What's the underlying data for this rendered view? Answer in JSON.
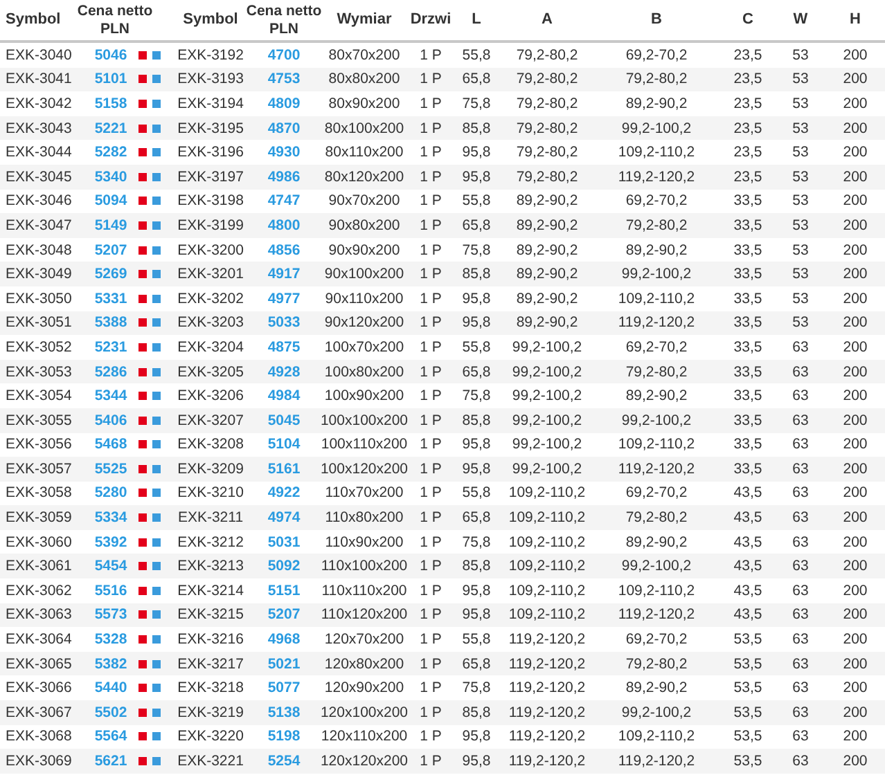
{
  "table": {
    "columns": [
      {
        "label": "Symbol",
        "kind": "text"
      },
      {
        "label": "Cena netto PLN",
        "kind": "price",
        "markers": true
      },
      {
        "label": "Symbol",
        "kind": "text"
      },
      {
        "label": "Cena netto PLN",
        "kind": "price"
      },
      {
        "label": "Wymiar",
        "kind": "text"
      },
      {
        "label": "Drzwi",
        "kind": "text"
      },
      {
        "label": "L",
        "kind": "text"
      },
      {
        "label": "A",
        "kind": "text"
      },
      {
        "label": "B",
        "kind": "text"
      },
      {
        "label": "C",
        "kind": "text"
      },
      {
        "label": "W",
        "kind": "text"
      },
      {
        "label": "H",
        "kind": "text"
      }
    ],
    "rows": [
      [
        "EXK-3040",
        "5046",
        "EXK-3192",
        "4700",
        "80x70x200",
        "1 P",
        "55,8",
        "79,2-80,2",
        "69,2-70,2",
        "23,5",
        "53",
        "200"
      ],
      [
        "EXK-3041",
        "5101",
        "EXK-3193",
        "4753",
        "80x80x200",
        "1 P",
        "65,8",
        "79,2-80,2",
        "79,2-80,2",
        "23,5",
        "53",
        "200"
      ],
      [
        "EXK-3042",
        "5158",
        "EXK-3194",
        "4809",
        "80x90x200",
        "1 P",
        "75,8",
        "79,2-80,2",
        "89,2-90,2",
        "23,5",
        "53",
        "200"
      ],
      [
        "EXK-3043",
        "5221",
        "EXK-3195",
        "4870",
        "80x100x200",
        "1 P",
        "85,8",
        "79,2-80,2",
        "99,2-100,2",
        "23,5",
        "53",
        "200"
      ],
      [
        "EXK-3044",
        "5282",
        "EXK-3196",
        "4930",
        "80x110x200",
        "1 P",
        "95,8",
        "79,2-80,2",
        "109,2-110,2",
        "23,5",
        "53",
        "200"
      ],
      [
        "EXK-3045",
        "5340",
        "EXK-3197",
        "4986",
        "80x120x200",
        "1 P",
        "95,8",
        "79,2-80,2",
        "119,2-120,2",
        "23,5",
        "53",
        "200"
      ],
      [
        "EXK-3046",
        "5094",
        "EXK-3198",
        "4747",
        "90x70x200",
        "1 P",
        "55,8",
        "89,2-90,2",
        "69,2-70,2",
        "33,5",
        "53",
        "200"
      ],
      [
        "EXK-3047",
        "5149",
        "EXK-3199",
        "4800",
        "90x80x200",
        "1 P",
        "65,8",
        "89,2-90,2",
        "79,2-80,2",
        "33,5",
        "53",
        "200"
      ],
      [
        "EXK-3048",
        "5207",
        "EXK-3200",
        "4856",
        "90x90x200",
        "1 P",
        "75,8",
        "89,2-90,2",
        "89,2-90,2",
        "33,5",
        "53",
        "200"
      ],
      [
        "EXK-3049",
        "5269",
        "EXK-3201",
        "4917",
        "90x100x200",
        "1 P",
        "85,8",
        "89,2-90,2",
        "99,2-100,2",
        "33,5",
        "53",
        "200"
      ],
      [
        "EXK-3050",
        "5331",
        "EXK-3202",
        "4977",
        "90x110x200",
        "1 P",
        "95,8",
        "89,2-90,2",
        "109,2-110,2",
        "33,5",
        "53",
        "200"
      ],
      [
        "EXK-3051",
        "5388",
        "EXK-3203",
        "5033",
        "90x120x200",
        "1 P",
        "95,8",
        "89,2-90,2",
        "119,2-120,2",
        "33,5",
        "53",
        "200"
      ],
      [
        "EXK-3052",
        "5231",
        "EXK-3204",
        "4875",
        "100x70x200",
        "1 P",
        "55,8",
        "99,2-100,2",
        "69,2-70,2",
        "33,5",
        "63",
        "200"
      ],
      [
        "EXK-3053",
        "5286",
        "EXK-3205",
        "4928",
        "100x80x200",
        "1 P",
        "65,8",
        "99,2-100,2",
        "79,2-80,2",
        "33,5",
        "63",
        "200"
      ],
      [
        "EXK-3054",
        "5344",
        "EXK-3206",
        "4984",
        "100x90x200",
        "1 P",
        "75,8",
        "99,2-100,2",
        "89,2-90,2",
        "33,5",
        "63",
        "200"
      ],
      [
        "EXK-3055",
        "5406",
        "EXK-3207",
        "5045",
        "100x100x200",
        "1 P",
        "85,8",
        "99,2-100,2",
        "99,2-100,2",
        "33,5",
        "63",
        "200"
      ],
      [
        "EXK-3056",
        "5468",
        "EXK-3208",
        "5104",
        "100x110x200",
        "1 P",
        "95,8",
        "99,2-100,2",
        "109,2-110,2",
        "33,5",
        "63",
        "200"
      ],
      [
        "EXK-3057",
        "5525",
        "EXK-3209",
        "5161",
        "100x120x200",
        "1 P",
        "95,8",
        "99,2-100,2",
        "119,2-120,2",
        "33,5",
        "63",
        "200"
      ],
      [
        "EXK-3058",
        "5280",
        "EXK-3210",
        "4922",
        "110x70x200",
        "1 P",
        "55,8",
        "109,2-110,2",
        "69,2-70,2",
        "43,5",
        "63",
        "200"
      ],
      [
        "EXK-3059",
        "5334",
        "EXK-3211",
        "4974",
        "110x80x200",
        "1 P",
        "65,8",
        "109,2-110,2",
        "79,2-80,2",
        "43,5",
        "63",
        "200"
      ],
      [
        "EXK-3060",
        "5392",
        "EXK-3212",
        "5031",
        "110x90x200",
        "1 P",
        "75,8",
        "109,2-110,2",
        "89,2-90,2",
        "43,5",
        "63",
        "200"
      ],
      [
        "EXK-3061",
        "5454",
        "EXK-3213",
        "5092",
        "110x100x200",
        "1 P",
        "85,8",
        "109,2-110,2",
        "99,2-100,2",
        "43,5",
        "63",
        "200"
      ],
      [
        "EXK-3062",
        "5516",
        "EXK-3214",
        "5151",
        "110x110x200",
        "1 P",
        "95,8",
        "109,2-110,2",
        "109,2-110,2",
        "43,5",
        "63",
        "200"
      ],
      [
        "EXK-3063",
        "5573",
        "EXK-3215",
        "5207",
        "110x120x200",
        "1 P",
        "95,8",
        "109,2-110,2",
        "119,2-120,2",
        "43,5",
        "63",
        "200"
      ],
      [
        "EXK-3064",
        "5328",
        "EXK-3216",
        "4968",
        "120x70x200",
        "1 P",
        "55,8",
        "119,2-120,2",
        "69,2-70,2",
        "53,5",
        "63",
        "200"
      ],
      [
        "EXK-3065",
        "5382",
        "EXK-3217",
        "5021",
        "120x80x200",
        "1 P",
        "65,8",
        "119,2-120,2",
        "79,2-80,2",
        "53,5",
        "63",
        "200"
      ],
      [
        "EXK-3066",
        "5440",
        "EXK-3218",
        "5077",
        "120x90x200",
        "1 P",
        "75,8",
        "119,2-120,2",
        "89,2-90,2",
        "53,5",
        "63",
        "200"
      ],
      [
        "EXK-3067",
        "5502",
        "EXK-3219",
        "5138",
        "120x100x200",
        "1 P",
        "85,8",
        "119,2-120,2",
        "99,2-100,2",
        "53,5",
        "63",
        "200"
      ],
      [
        "EXK-3068",
        "5564",
        "EXK-3220",
        "5198",
        "120x110x200",
        "1 P",
        "95,8",
        "119,2-120,2",
        "109,2-110,2",
        "53,5",
        "63",
        "200"
      ],
      [
        "EXK-3069",
        "5621",
        "EXK-3221",
        "5254",
        "120x120x200",
        "1 P",
        "95,8",
        "119,2-120,2",
        "119,2-120,2",
        "53,5",
        "63",
        "200"
      ]
    ]
  }
}
